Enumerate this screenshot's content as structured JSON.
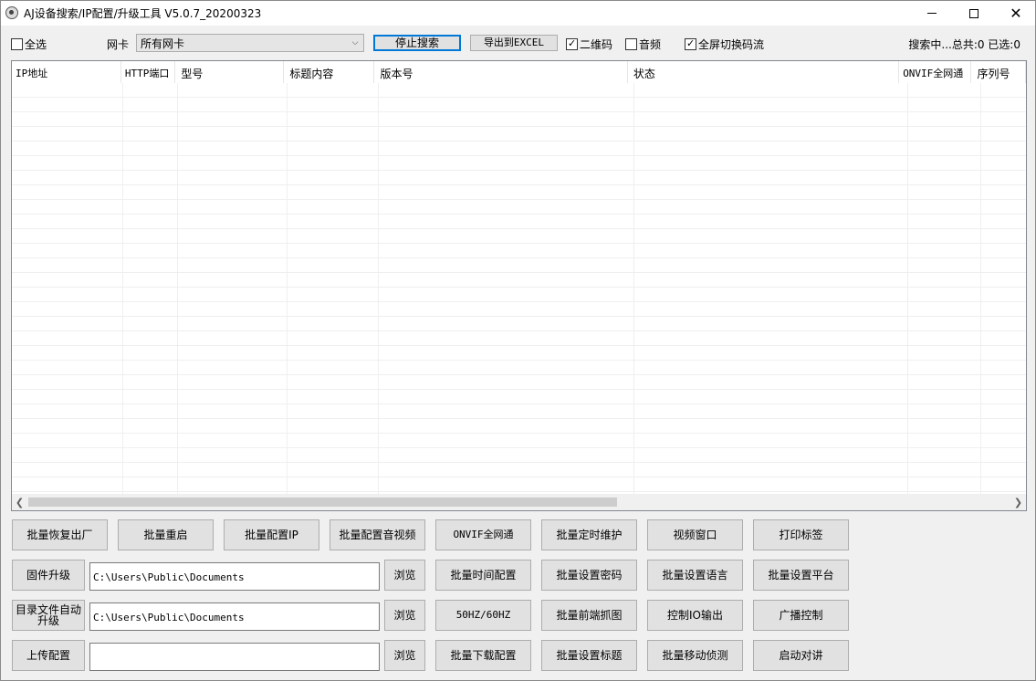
{
  "window": {
    "title": "AJ设备搜索/IP配置/升级工具 V5.0.7_20200323",
    "controls": {
      "minimize": "—",
      "maximize": "☐",
      "close": "✕"
    }
  },
  "toolbar": {
    "select_all_label": "全选",
    "select_all_checked": false,
    "nic_label": "网卡",
    "nic_value": "所有网卡",
    "stop_search_label": "停止搜索",
    "export_label": "导出到EXCEL",
    "qrcode_label": "二维码",
    "qrcode_checked": true,
    "audio_label": "音频",
    "audio_checked": false,
    "fullscreen_label": "全屏切换码流",
    "fullscreen_checked": true,
    "status_text": "搜索中...总共:0 已选:0"
  },
  "grid": {
    "columns": [
      "IP地址",
      "HTTP端口",
      "型号",
      "标题内容",
      "版本号",
      "状态",
      "ONVIF全网通",
      "序列号"
    ],
    "rows": []
  },
  "actions_row1": [
    "批量恢复出厂",
    "批量重启",
    "批量配置IP",
    "批量配置音视频",
    "ONVIF全网通",
    "批量定时维护",
    "视频窗口",
    "打印标签"
  ],
  "firmware": {
    "label": "固件升级",
    "path": "C:\\Users\\Public\\Documents",
    "browse": "浏览",
    "actions": [
      "批量时间配置",
      "批量设置密码",
      "批量设置语言",
      "批量设置平台"
    ]
  },
  "dir_upgrade": {
    "label": "目录文件自动升级",
    "path": "C:\\Users\\Public\\Documents",
    "browse": "浏览",
    "actions": [
      "50HZ/60HZ",
      "批量前端抓图",
      "控制IO输出",
      "广播控制"
    ]
  },
  "upload": {
    "label": "上传配置",
    "path": "",
    "browse": "浏览",
    "actions": [
      "批量下载配置",
      "批量设置标题",
      "批量移动侦测",
      "启动对讲"
    ]
  },
  "icons": {
    "app": "app-icon",
    "dropdown": "chevron-down-icon",
    "scroll_left": "chevron-left-icon",
    "scroll_right": "chevron-right-icon"
  },
  "colors": {
    "window_bg": "#f0f0f0",
    "button_bg": "#e1e1e1",
    "focus_border": "#0078d7"
  }
}
